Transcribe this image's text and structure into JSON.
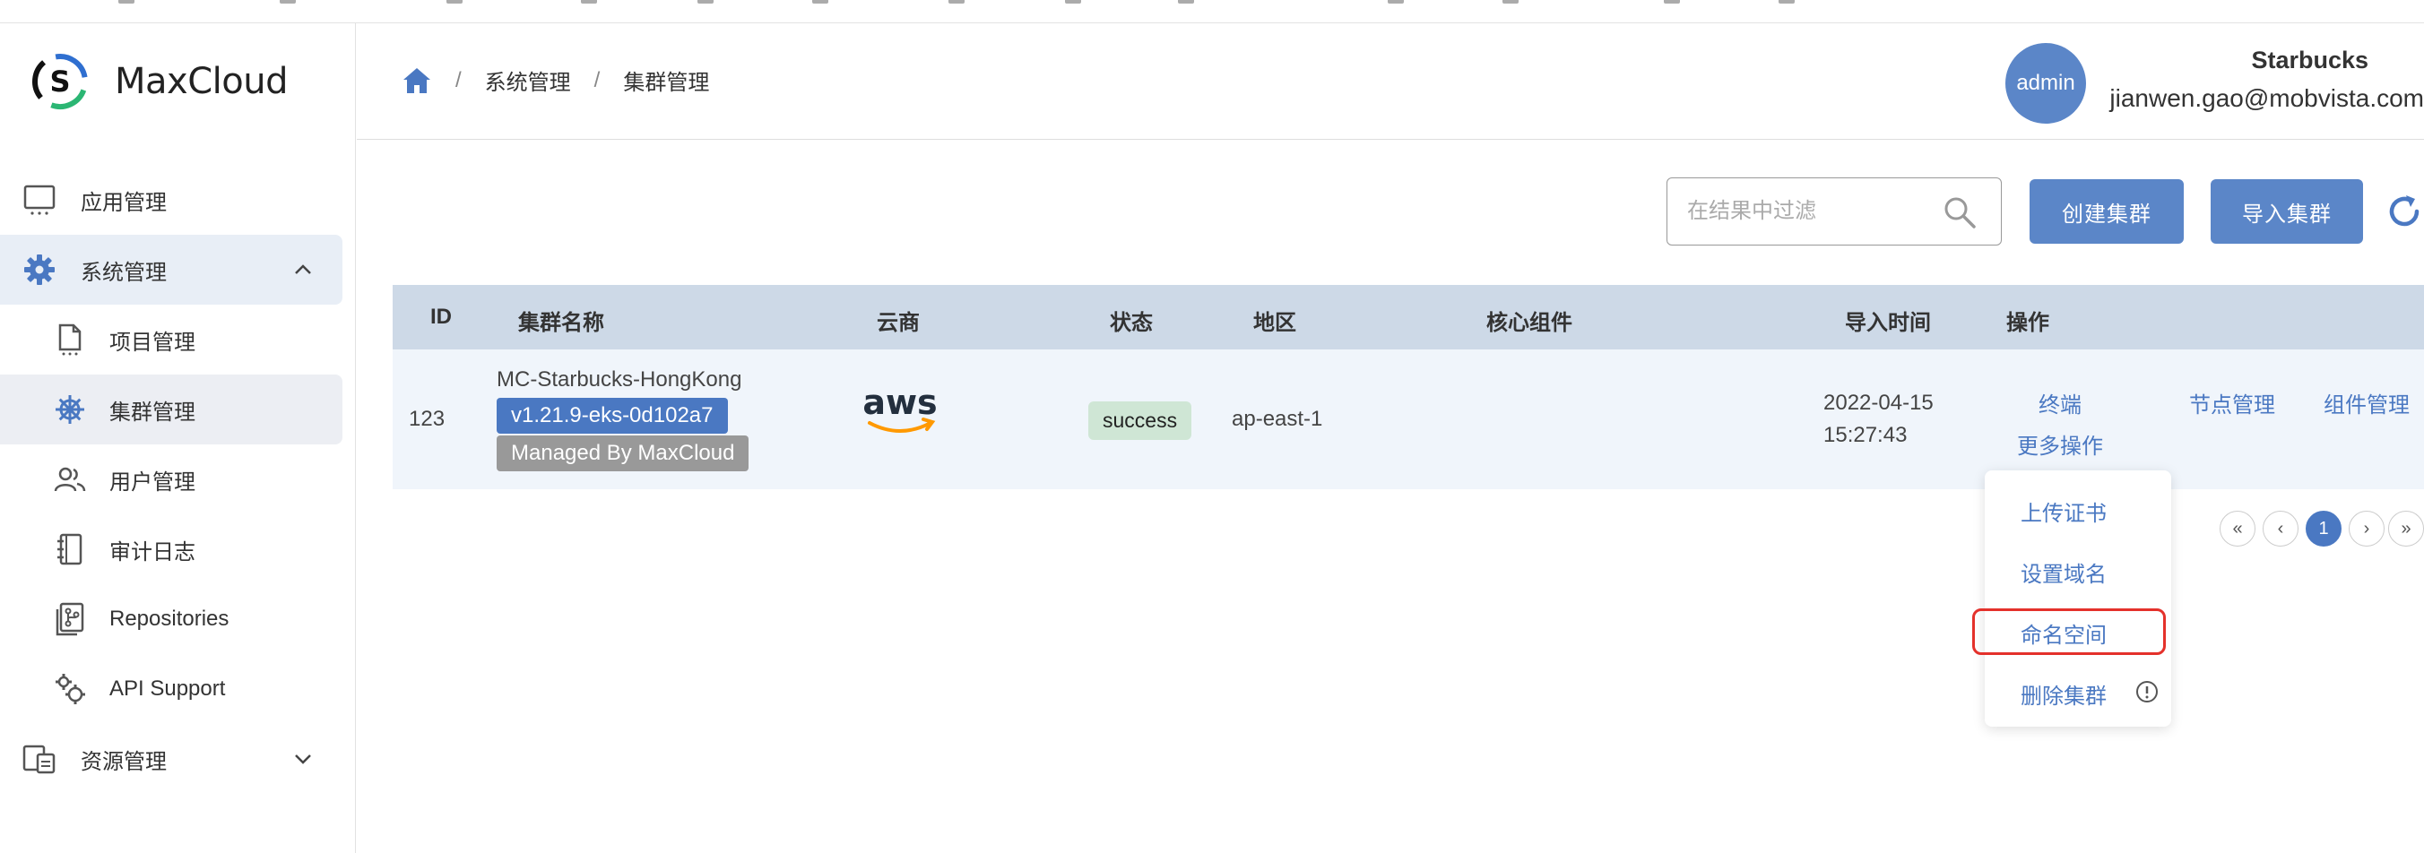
{
  "app": {
    "name": "MaxCloud"
  },
  "sidebar": {
    "items": [
      {
        "label": "应用管理",
        "icon": "monitor-icon"
      },
      {
        "label": "系统管理",
        "icon": "gear-icon",
        "expanded": true
      },
      {
        "label": "项目管理",
        "icon": "document-icon"
      },
      {
        "label": "集群管理",
        "icon": "helm-icon",
        "selected": true
      },
      {
        "label": "用户管理",
        "icon": "users-icon"
      },
      {
        "label": "审计日志",
        "icon": "notebook-icon"
      },
      {
        "label": "Repositories",
        "icon": "repo-icon"
      },
      {
        "label": "API Support",
        "icon": "gears-icon"
      },
      {
        "label": "资源管理",
        "icon": "resources-icon"
      }
    ]
  },
  "breadcrumb": {
    "home_icon": "home-icon",
    "items": [
      "系统管理",
      "集群管理"
    ],
    "separator": "/"
  },
  "user": {
    "avatar_text": "admin",
    "org": "Starbucks",
    "email": "jianwen.gao@mobvista.com"
  },
  "toolbar": {
    "search_placeholder": "在结果中过滤",
    "create_label": "创建集群",
    "import_label": "导入集群"
  },
  "table": {
    "headers": {
      "id": "ID",
      "name": "集群名称",
      "cloud": "云商",
      "status": "状态",
      "region": "地区",
      "core": "核心组件",
      "import_time": "导入时间",
      "actions": "操作"
    },
    "rows": [
      {
        "id": "123",
        "name": "MC-Starbucks-HongKong",
        "version_tag": "v1.21.9-eks-0d102a7",
        "managed_tag": "Managed By MaxCloud",
        "cloud": "aws",
        "status": "success",
        "region": "ap-east-1",
        "core": "",
        "import_date": "2022-04-15",
        "import_time": "15:27:43",
        "action_terminal": "终端",
        "action_nodes": "节点管理",
        "action_components": "组件管理",
        "action_more": "更多操作"
      }
    ]
  },
  "more_menu": {
    "items": [
      "上传证书",
      "设置域名",
      "命名空间",
      "删除集群"
    ],
    "highlighted": "命名空间"
  },
  "pagination": {
    "first": "«",
    "prev": "‹",
    "current": "1",
    "next": "›",
    "last": "»"
  },
  "colors": {
    "primary": "#5b86c8",
    "link": "#4a78c2",
    "header_bg": "#cdd9e7",
    "row_bg": "#f0f5fb",
    "success_bg": "#cfe6d5",
    "highlight": "#e4312b"
  }
}
